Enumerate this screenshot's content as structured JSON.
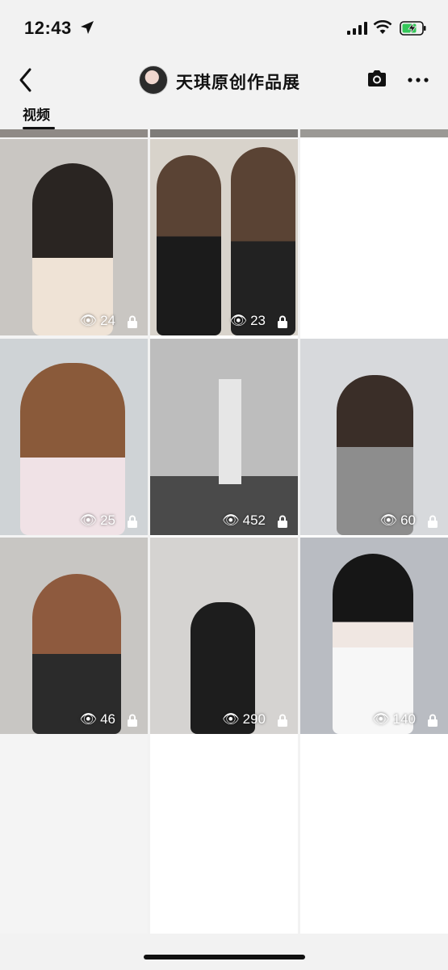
{
  "status_bar": {
    "time": "12:43"
  },
  "header": {
    "title": "天琪原创作品展"
  },
  "tabs": [
    {
      "label": "视频"
    }
  ],
  "tiles": [
    {
      "views": "24",
      "bg": "#c9c6c2",
      "accent": "#2a2522"
    },
    {
      "views": "23",
      "bg": "#d8d3cb",
      "accent": "#5a4334"
    },
    {
      "views": "",
      "bg": "#f4f4f4",
      "accent": "#f4f4f4"
    },
    {
      "views": "25",
      "bg": "#cfd3d6",
      "accent": "#8a5a3a"
    },
    {
      "views": "452",
      "bg": "#bdbdbd",
      "accent": "#7a7a7a"
    },
    {
      "views": "60",
      "bg": "#d7d9dc",
      "accent": "#3a2e28"
    },
    {
      "views": "46",
      "bg": "#c8c6c3",
      "accent": "#8e5a3e"
    },
    {
      "views": "290",
      "bg": "#d5d3d1",
      "accent": "#1d1d1d"
    },
    {
      "views": "140",
      "bg": "#b9bcc2",
      "accent": "#161616"
    }
  ],
  "colors": {
    "background": "#f2f2f2",
    "text": "#111111"
  }
}
